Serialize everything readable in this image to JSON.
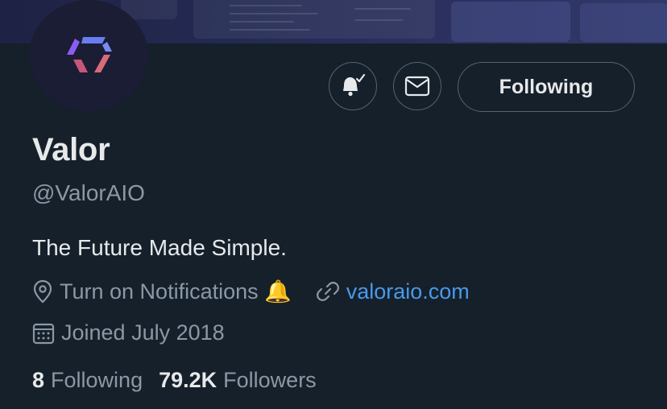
{
  "profile": {
    "name": "Valor",
    "handle": "@ValorAIO",
    "bio": "The Future Made Simple.",
    "location": "Turn on Notifications 🔔",
    "website": "valoraio.com",
    "joined": "Joined July 2018"
  },
  "actions": {
    "notifications_icon": "bell-check-icon",
    "message_icon": "envelope-icon",
    "follow_label": "Following"
  },
  "stats": {
    "following_count": "8",
    "following_label": "Following",
    "followers_count": "79.2K",
    "followers_label": "Followers"
  },
  "colors": {
    "background": "#15202b",
    "secondary_text": "#8b98a5",
    "link": "#4a99e9",
    "button_border": "#536471"
  }
}
